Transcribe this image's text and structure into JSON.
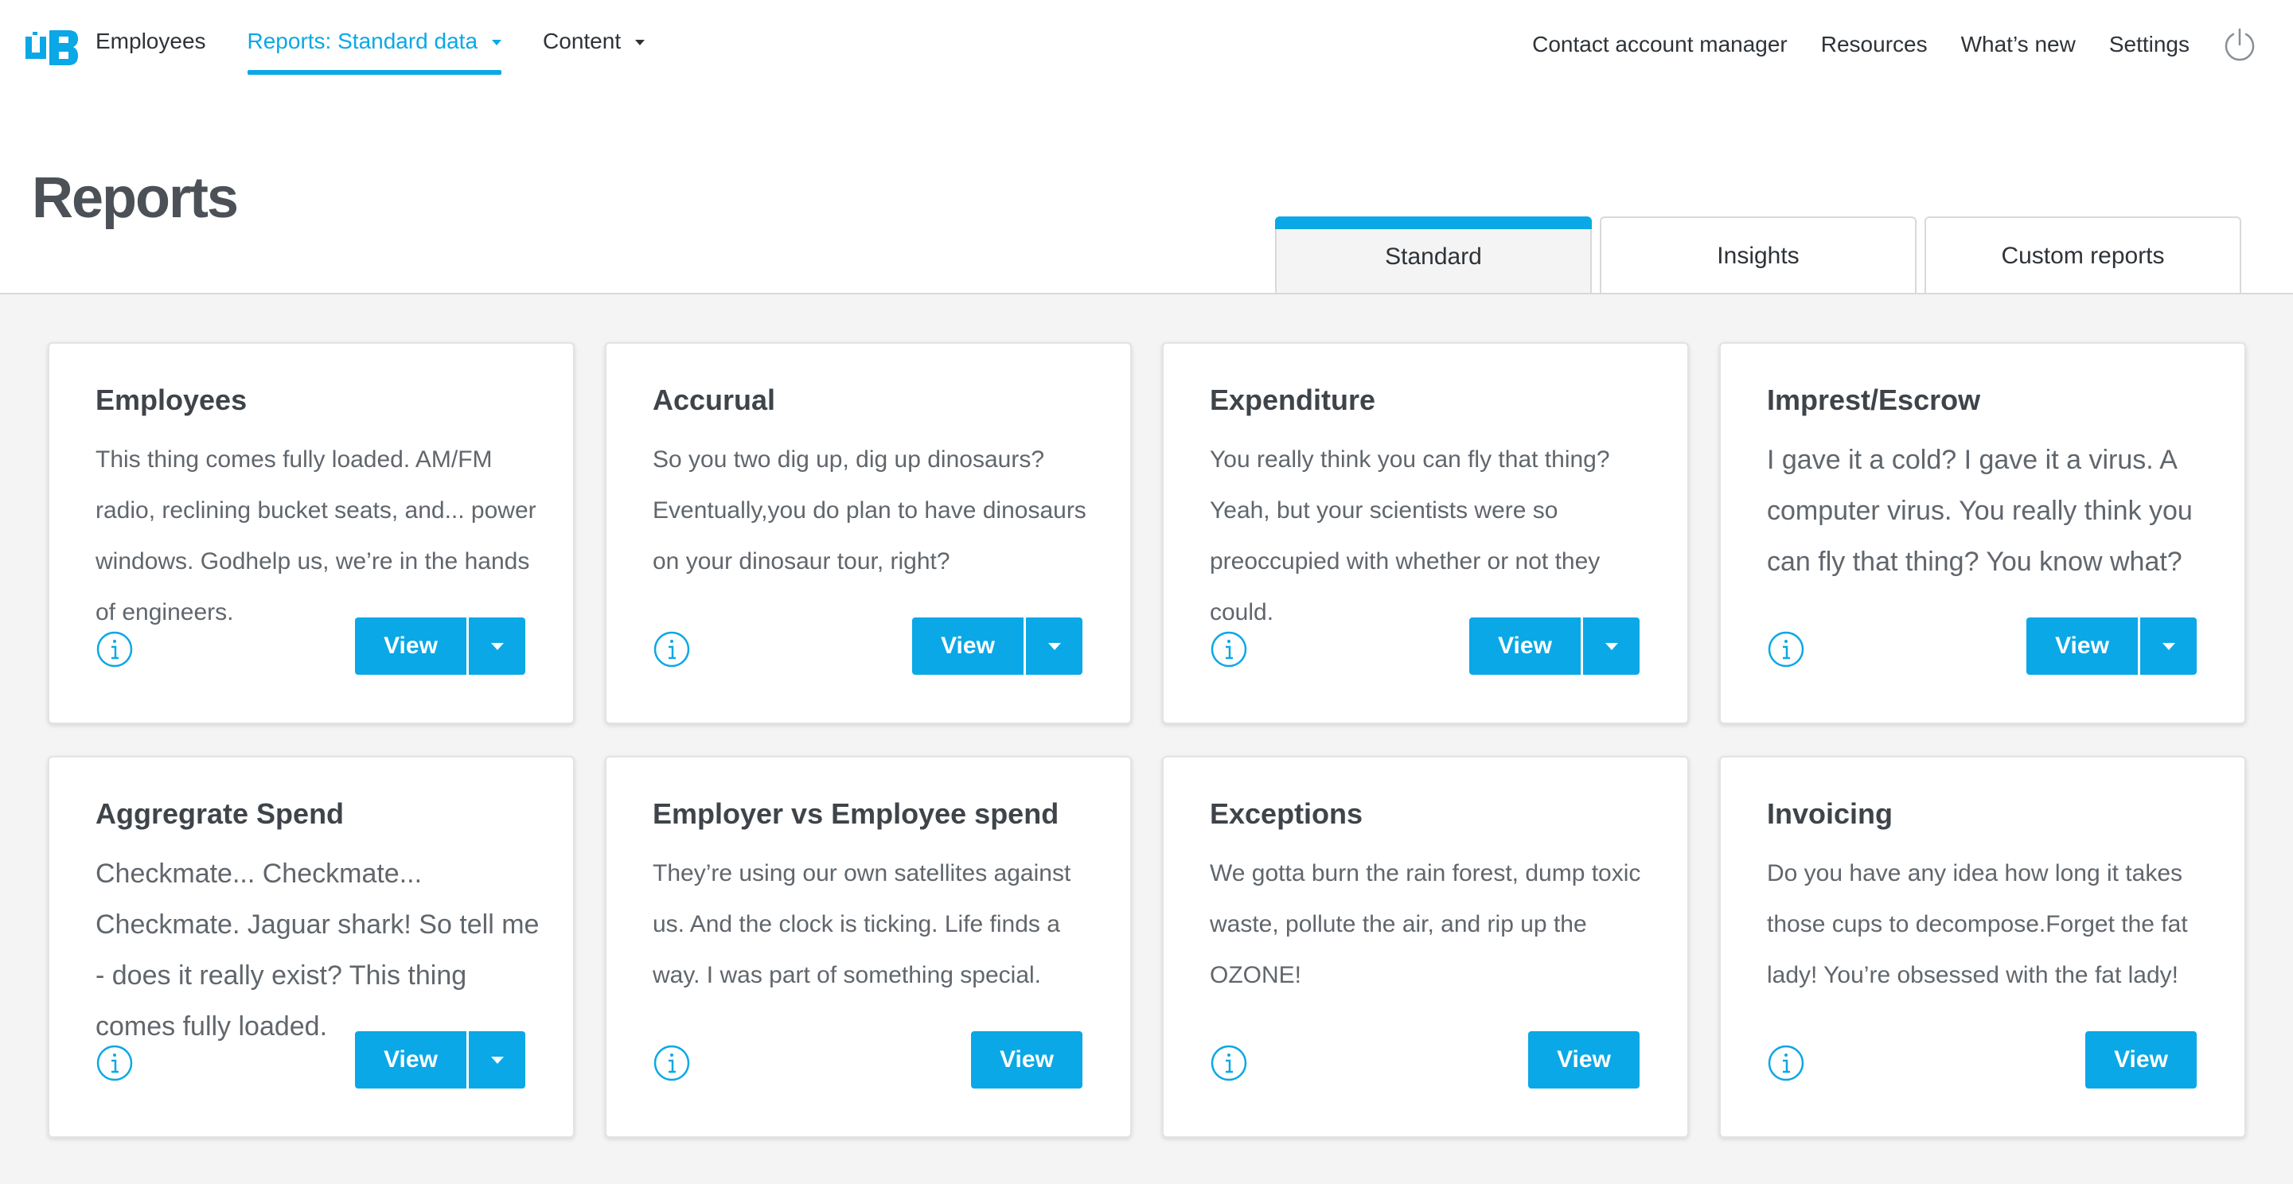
{
  "brand": {
    "logo_text": "UB",
    "accent": "#0aa8e6"
  },
  "nav": {
    "left": [
      {
        "label": "Employees",
        "active": false,
        "dropdown": false
      },
      {
        "label": "Reports: Standard data",
        "active": true,
        "dropdown": true
      },
      {
        "label": "Content",
        "active": false,
        "dropdown": true
      }
    ],
    "right": [
      {
        "label": "Contact account manager"
      },
      {
        "label": "Resources"
      },
      {
        "label": "What’s new"
      },
      {
        "label": "Settings"
      }
    ],
    "power_icon": "power-icon"
  },
  "page": {
    "title": "Reports"
  },
  "tabs": [
    {
      "label": "Standard",
      "active": true
    },
    {
      "label": "Insights",
      "active": false
    },
    {
      "label": "Custom reports",
      "active": false
    }
  ],
  "cards": [
    {
      "title": "Employees",
      "description": "This thing comes fully loaded. AM/FM radio, reclining bucket seats, and... power windows. Godhelp us, we’re in the hands of engineers.",
      "view_label": "View",
      "has_dropdown": true
    },
    {
      "title": "Accurual",
      "description": "So you two dig up, dig up dinosaurs? Eventually,you do plan to have dinosaurs on your dinosaur tour, right?",
      "view_label": "View",
      "has_dropdown": true
    },
    {
      "title": "Expenditure",
      "description": "You really think you can fly that thing? Yeah, but your scientists were so preoccupied with whether or not they could.",
      "view_label": "View",
      "has_dropdown": true
    },
    {
      "title": "Imprest/Escrow",
      "description": "I gave it a cold? I gave it a virus. A computer virus. You really think you can fly that thing? You know what?",
      "view_label": "View",
      "has_dropdown": true
    },
    {
      "title": "Aggregrate Spend",
      "description": "Checkmate... Checkmate... Checkmate. Jaguar shark! So tell me - does it really exist? This thing comes fully loaded.",
      "view_label": "View",
      "has_dropdown": true
    },
    {
      "title": "Employer vs Employee spend",
      "description": "They’re using our own satellites against us. And the clock is ticking. Life finds a way. I was part of something special.",
      "view_label": "View",
      "has_dropdown": false
    },
    {
      "title": "Exceptions",
      "description": "We gotta burn the rain forest, dump toxic waste, pollute the air, and rip up the OZONE!",
      "view_label": "View",
      "has_dropdown": false
    },
    {
      "title": "Invoicing",
      "description": "Do you have any idea how long it takes those cups to decompose.Forget the fat lady! You’re obsessed with the fat lady!",
      "view_label": "View",
      "has_dropdown": false
    }
  ]
}
